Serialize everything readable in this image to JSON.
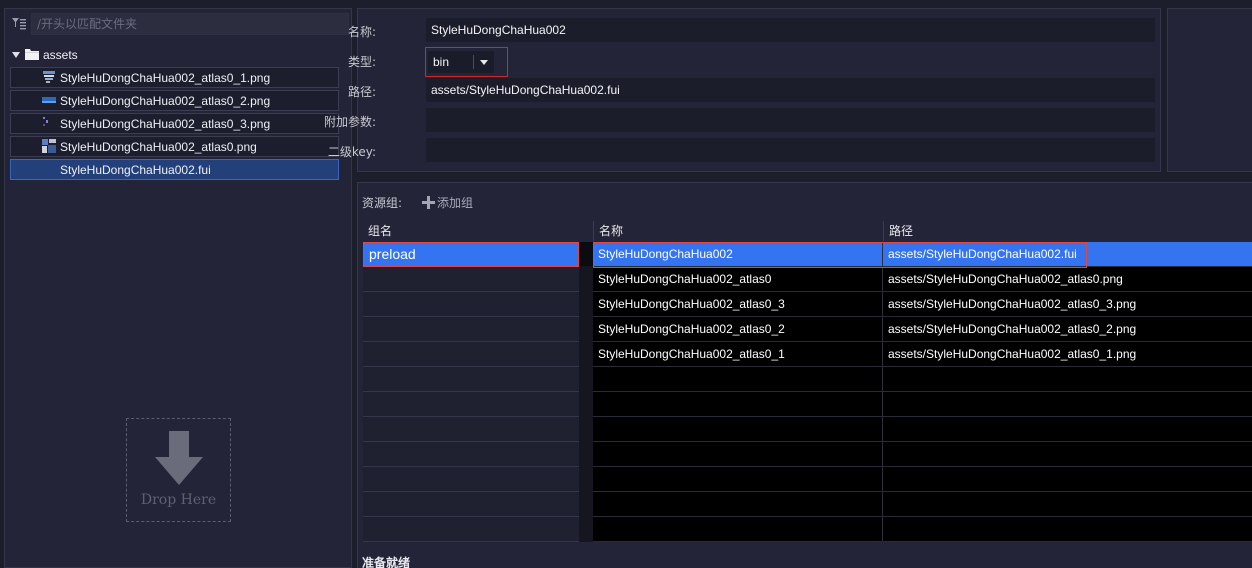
{
  "filter": {
    "placeholder": "/开头以匹配文件夹"
  },
  "tree": {
    "root_label": "assets",
    "files": [
      {
        "name": "StyleHuDongChaHua002_atlas0_1.png",
        "icon": "image-thumbnail-icon",
        "selected": false
      },
      {
        "name": "StyleHuDongChaHua002_atlas0_2.png",
        "icon": "image-thumbnail-icon",
        "selected": false
      },
      {
        "name": "StyleHuDongChaHua002_atlas0_3.png",
        "icon": "image-thumbnail-icon",
        "selected": false
      },
      {
        "name": "StyleHuDongChaHua002_atlas0.png",
        "icon": "image-thumbnail-icon",
        "selected": false
      },
      {
        "name": "StyleHuDongChaHua002.fui",
        "icon": "",
        "selected": true
      }
    ]
  },
  "drop_zone": {
    "text": "Drop Here",
    "icon": "arrow-down-icon"
  },
  "props": {
    "name_label": "名称:",
    "name_value": "StyleHuDongChaHua002",
    "type_label": "类型:",
    "type_value": "bin",
    "path_label": "路径:",
    "path_value": "assets/StyleHuDongChaHua002.fui",
    "extra_label": "附加参数:",
    "extra_value": "",
    "subkey_label": "二级key:",
    "subkey_value": ""
  },
  "groups": {
    "label": "资源组:",
    "add_label": "添加组",
    "col_group": "组名",
    "col_name": "名称",
    "col_path": "路径",
    "items": [
      {
        "name": "preload",
        "selected": true
      }
    ],
    "empty_rows": 11
  },
  "assets": {
    "rows": [
      {
        "name": "StyleHuDongChaHua002",
        "path": "assets/StyleHuDongChaHua002.fui",
        "selected": true
      },
      {
        "name": "StyleHuDongChaHua002_atlas0",
        "path": "assets/StyleHuDongChaHua002_atlas0.png",
        "selected": false
      },
      {
        "name": "StyleHuDongChaHua002_atlas0_3",
        "path": "assets/StyleHuDongChaHua002_atlas0_3.png",
        "selected": false
      },
      {
        "name": "StyleHuDongChaHua002_atlas0_2",
        "path": "assets/StyleHuDongChaHua002_atlas0_2.png",
        "selected": false
      },
      {
        "name": "StyleHuDongChaHua002_atlas0_1",
        "path": "assets/StyleHuDongChaHua002_atlas0_1.png",
        "selected": false
      }
    ],
    "empty_rows": 7
  },
  "status_text": "准备就绪",
  "colors": {
    "selection": "#3574f0",
    "highlight_border": "#e04646",
    "panel_bg": "#232437"
  }
}
